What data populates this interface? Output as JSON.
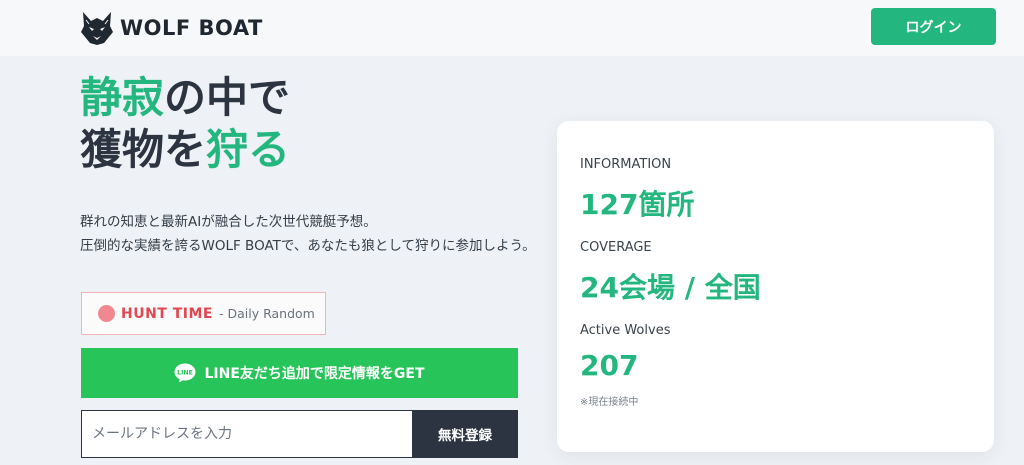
{
  "header": {
    "logo_text": "WOLF BOAT",
    "logo_icon": "wolf-head-icon",
    "login_label": "ログイン"
  },
  "hero": {
    "line1": {
      "accent": "静寂",
      "rest": "の中で"
    },
    "line2": {
      "start": "獲物を",
      "accent": "狩る"
    },
    "description_line1": "群れの知恵と最新AIが融合した次世代競艇予想。",
    "description_line2": "圧倒的な実績を誇るWOLF BOATで、あなたも狼として狩りに参加しよう。"
  },
  "hunt": {
    "label": "HUNT TIME",
    "sub": "- Daily Random"
  },
  "line_button": {
    "label": "LINE友だち追加で限定情報をGET",
    "icon_text": "LINE"
  },
  "signup": {
    "placeholder": "メールアドレスを入力",
    "button_label": "無料登録"
  },
  "stats": {
    "information_label": "INFORMATION",
    "information_value": "127箇所",
    "coverage_label": "COVERAGE",
    "coverage_value": "24会場 / 全国",
    "wolves_label": "Active Wolves",
    "wolves_value": "207",
    "wolves_note": "※現在接続中"
  },
  "colors": {
    "accent": "#23b77f",
    "line_green": "#27c45a",
    "dark": "#2b3440",
    "hunt_red": "#e2474f"
  }
}
